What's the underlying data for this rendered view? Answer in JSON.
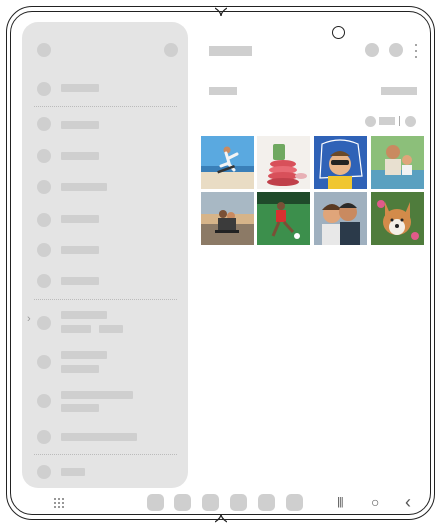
{
  "device": {
    "description_colors": {
      "panel": "#e4e4e4",
      "placeholder": "#cfcfcf",
      "outline": "#222222"
    }
  },
  "drawer": {
    "items": [
      {
        "icon": "placeholder-dot"
      },
      {
        "icon": "placeholder-dot"
      },
      {
        "icon": "placeholder-dot"
      },
      {
        "icon": "placeholder-dot"
      },
      {
        "icon": "placeholder-dot"
      },
      {
        "icon": "placeholder-dot"
      },
      {
        "icon": "placeholder-dot"
      },
      {
        "icon": "placeholder-dot"
      },
      {
        "icon": "placeholder-dot"
      },
      {
        "icon": "placeholder-dot"
      },
      {
        "icon": "placeholder-dot"
      },
      {
        "icon": "placeholder-dot"
      },
      {
        "icon": "placeholder-dot"
      }
    ]
  },
  "gallery": {
    "thumbnails": [
      {
        "subject": "skateboarder-jump"
      },
      {
        "subject": "macarons-stack"
      },
      {
        "subject": "boy-with-sunglasses"
      },
      {
        "subject": "man-with-child"
      },
      {
        "subject": "couple-on-skateboard"
      },
      {
        "subject": "soccer-player"
      },
      {
        "subject": "couple-selfie"
      },
      {
        "subject": "corgi-dog"
      }
    ]
  },
  "navbar": {
    "recents_glyph": "|||",
    "home_glyph": "○",
    "back_glyph": "‹"
  }
}
